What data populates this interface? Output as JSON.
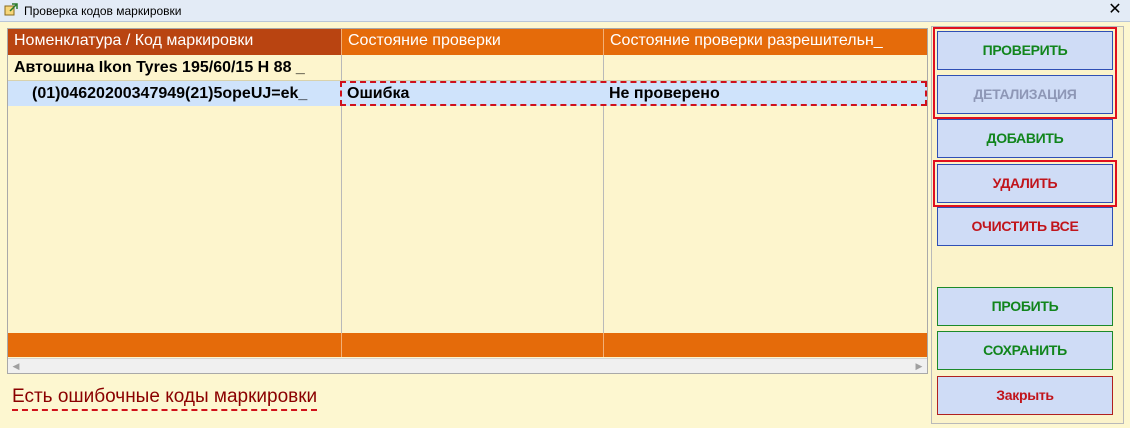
{
  "window": {
    "title": "Проверка кодов маркировки",
    "close_glyph": "✕"
  },
  "grid": {
    "columns": [
      "Номенклатура / Код маркировки",
      "Состояние проверки",
      "Состояние проверки разрешительн_"
    ],
    "rows": [
      [
        "Автошина Ikon Tyres  195/60/15  H 88 _",
        "",
        ""
      ],
      [
        "(01)04620200347949(21)5opeUJ=ek_",
        "Ошибка",
        "Не проверено"
      ]
    ]
  },
  "status_message": "Есть ошибочные коды маркировки",
  "buttons": {
    "check": "ПРОВЕРИТЬ",
    "details": "ДЕТАЛИЗАЦИЯ",
    "add": "ДОБАВИТЬ",
    "delete": "УДАЛИТЬ",
    "clear_all": "ОЧИСТИТЬ ВСЕ",
    "punch": "ПРОБИТЬ",
    "save": "СОХРАНИТЬ",
    "close": "Закрыть"
  },
  "colors": {
    "header_primary": "#b94411",
    "header_secondary": "#e56b0a",
    "background": "#fdf5cd",
    "selected_row": "#cfe3fb",
    "error_text": "#8b0000",
    "highlight_border": "#e0101e"
  },
  "icons": {
    "app": "app-window-icon",
    "close": "close-icon",
    "scroll_left": "scroll-left-icon",
    "scroll_right": "scroll-right-icon"
  }
}
